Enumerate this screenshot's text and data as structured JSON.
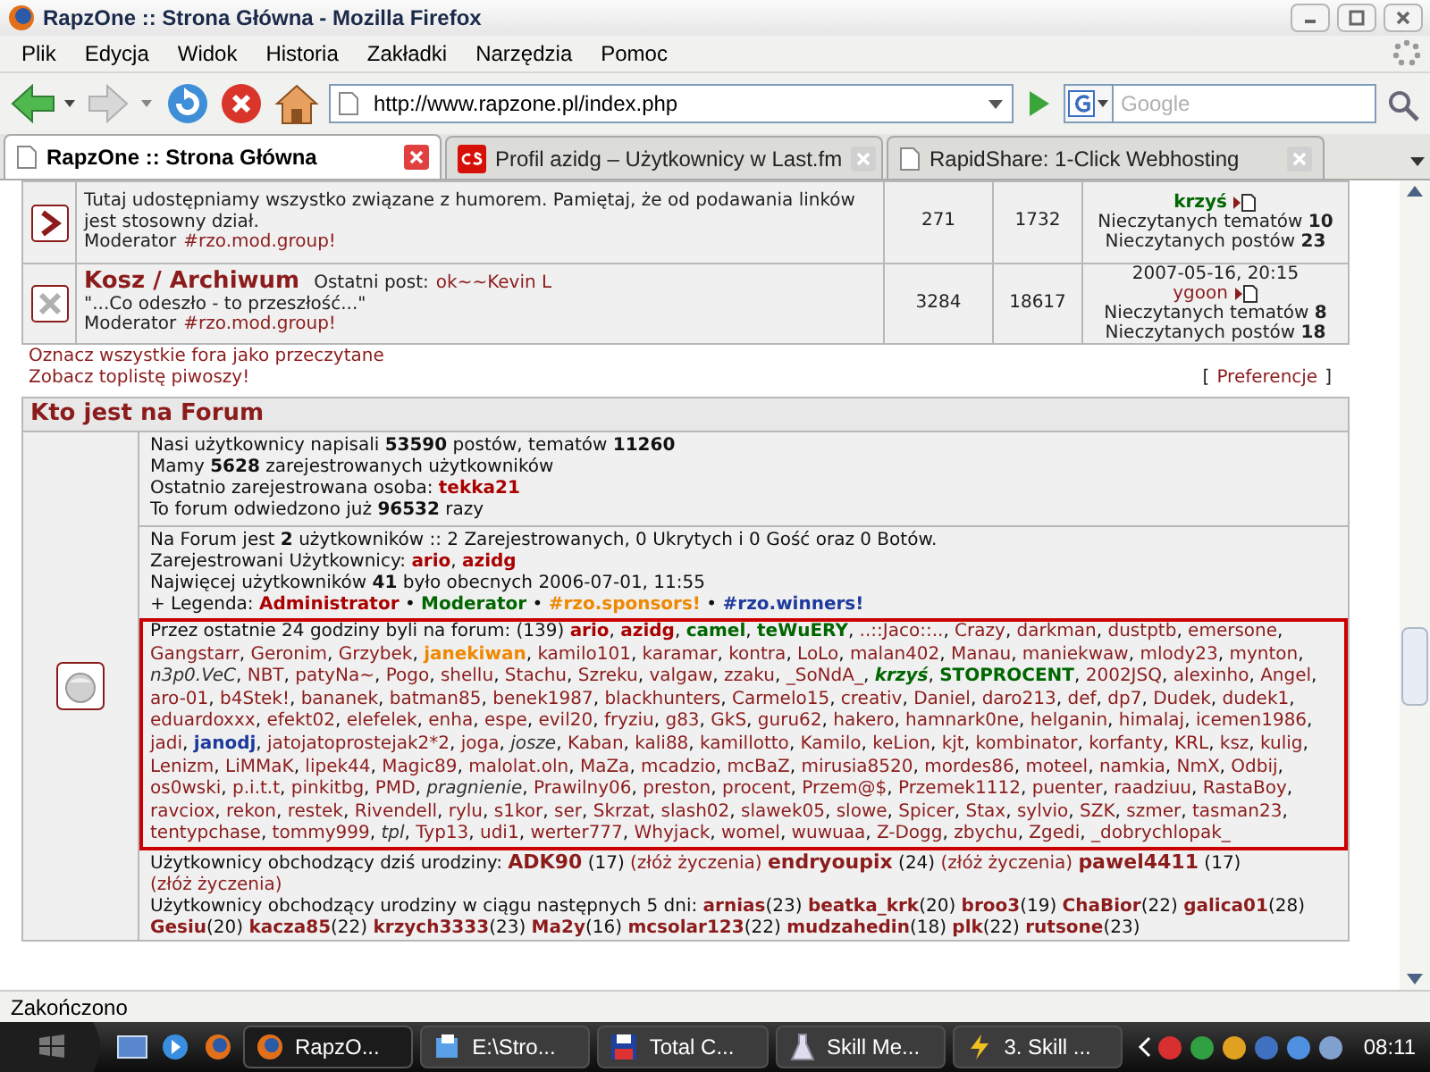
{
  "window": {
    "title": "RapzOne :: Strona Główna - Mozilla Firefox"
  },
  "menu": [
    "Plik",
    "Edycja",
    "Widok",
    "Historia",
    "Zakładki",
    "Narzędzia",
    "Pomoc"
  ],
  "toolbar": {
    "url": "http://www.rapzone.pl/index.php",
    "search_placeholder": "Google"
  },
  "tabs": [
    {
      "label": "RapzOne :: Strona Główna",
      "selected": true,
      "kind": "page"
    },
    {
      "label": "Profil azidg – Użytkownicy w Last.fm",
      "selected": false,
      "kind": "lastfm"
    },
    {
      "label": "RapidShare: 1-Click Webhosting",
      "selected": false,
      "kind": "page"
    }
  ],
  "forums": [
    {
      "kind": "new",
      "description": "Tutaj udostępniamy wszystko związane z humorem. Pamiętaj, że od podawania linków jest stosowny dział.",
      "moderator_label": "Moderator",
      "moderator": "#rzo.mod.group!",
      "topics": "271",
      "posts": "1732",
      "user": {
        "name": "krzyś",
        "kind": "moderator"
      },
      "unread_topics_label": "Nieczytanych tematów",
      "unread_topics": "10",
      "unread_posts_label": "Nieczytanych postów",
      "unread_posts": "23"
    },
    {
      "kind": "locked",
      "title": "Kosz / Archiwum",
      "last_label": "Ostatni post:",
      "last_user": "ok~~Kevin L",
      "description": "\"...Co odeszło - to przeszłość...\"",
      "moderator_label": "Moderator",
      "moderator": "#rzo.mod.group!",
      "topics": "3284",
      "posts": "18617",
      "date": "2007-05-16, 20:15",
      "user": {
        "name": "ygoon",
        "kind": "plain"
      },
      "unread_topics_label": "Nieczytanych tematów",
      "unread_topics": "8",
      "unread_posts_label": "Nieczytanych postów",
      "unread_posts": "18"
    }
  ],
  "links": [
    "Oznacz wszystkie fora jako przeczytane",
    "Zobacz toplistę piwoszy!"
  ],
  "preferences": {
    "open": "[",
    "label": "Preferencje",
    "close": "]"
  },
  "who": {
    "title": "Kto jest na Forum",
    "stats": [
      {
        "text": "Nasi użytkownicy napisali **53590** postów, tematów **11260**"
      },
      {
        "text": "Mamy **5628** zarejestrowanych użytkowników"
      },
      {
        "text": "Ostatnio zarejestrowana osoba:",
        "link": "tekka21"
      },
      {
        "text": "To forum odwiedzono już **96532** razy"
      }
    ],
    "online_line": "Na Forum jest **2** użytkowników :: 2 Zarejestrowanych, 0 Ukrytych i 0 Gość oraz 0 Botów.",
    "registered_label": "Zarejestrowani Użytkownicy:",
    "registered": [
      {
        "name": "ario",
        "kind": "admin"
      },
      {
        "name": "azidg",
        "kind": "admin"
      }
    ],
    "record_line": "Najwięcej użytkowników **41** było obecnych 2006-07-01, 11:55",
    "legend_label": "+ Legenda:",
    "legend": [
      {
        "name": "Administrator",
        "kind": "admin"
      },
      {
        "name": "Moderator",
        "kind": "moderator"
      },
      {
        "name": "#rzo.sponsors!",
        "kind": "sponsor"
      },
      {
        "name": "#rzo.winners!",
        "kind": "winner"
      }
    ],
    "legend_separator": "•",
    "separator": ",",
    "last24_intro": "Przez ostatnie 24 godziny byli na forum: (139)",
    "last24": [
      {
        "name": "ario",
        "kind": "admin"
      },
      {
        "name": "azidg",
        "kind": "admin"
      },
      {
        "name": "camel",
        "kind": "moderator"
      },
      {
        "name": "teWuERY",
        "kind": "moderator"
      },
      {
        "name": "..::Jaco::..",
        "kind": "plain"
      },
      {
        "name": "Crazy",
        "kind": "plain"
      },
      {
        "name": "darkman",
        "kind": "plain"
      },
      {
        "name": "dustptb",
        "kind": "plain"
      },
      {
        "name": "emersone",
        "kind": "plain"
      },
      {
        "name": "Gangstarr",
        "kind": "plain"
      },
      {
        "name": "Geronim",
        "kind": "plain"
      },
      {
        "name": "Grzybek",
        "kind": "plain"
      },
      {
        "name": "janekiwan",
        "kind": "sponsor"
      },
      {
        "name": "kamilo101",
        "kind": "plain"
      },
      {
        "name": "karamar",
        "kind": "plain"
      },
      {
        "name": "kontra",
        "kind": "plain"
      },
      {
        "name": "LoLo",
        "kind": "plain"
      },
      {
        "name": "malan402",
        "kind": "plain"
      },
      {
        "name": "Manau",
        "kind": "plain"
      },
      {
        "name": "maniekwaw",
        "kind": "plain"
      },
      {
        "name": "mlody23",
        "kind": "plain"
      },
      {
        "name": "mynton",
        "kind": "plain"
      },
      {
        "name": "n3p0.VeC",
        "kind": "italic"
      },
      {
        "name": "NBT",
        "kind": "plain"
      },
      {
        "name": "patyNa~",
        "kind": "plain"
      },
      {
        "name": "Pogo",
        "kind": "plain"
      },
      {
        "name": "shellu",
        "kind": "plain"
      },
      {
        "name": "Stachu",
        "kind": "plain"
      },
      {
        "name": "Szreku",
        "kind": "plain"
      },
      {
        "name": "valgaw",
        "kind": "plain"
      },
      {
        "name": "zzaku",
        "kind": "plain"
      },
      {
        "name": "_SoNdA_",
        "kind": "plain"
      },
      {
        "name": "krzyś",
        "kind": "moderator_italic"
      },
      {
        "name": "STOPROCENT",
        "kind": "moderator"
      },
      {
        "name": "2002JSQ",
        "kind": "plain"
      },
      {
        "name": "alexinho",
        "kind": "plain"
      },
      {
        "name": "Angel",
        "kind": "plain"
      },
      {
        "name": "aro-01",
        "kind": "plain"
      },
      {
        "name": "b4Stek!",
        "kind": "plain"
      },
      {
        "name": "bananek",
        "kind": "plain"
      },
      {
        "name": "batman85",
        "kind": "plain"
      },
      {
        "name": "benek1987",
        "kind": "plain"
      },
      {
        "name": "blackhunters",
        "kind": "plain"
      },
      {
        "name": "Carmelo15",
        "kind": "plain"
      },
      {
        "name": "creativ",
        "kind": "plain"
      },
      {
        "name": "Daniel",
        "kind": "plain"
      },
      {
        "name": "daro213",
        "kind": "plain"
      },
      {
        "name": "def",
        "kind": "plain"
      },
      {
        "name": "dp7",
        "kind": "plain"
      },
      {
        "name": "Dudek",
        "kind": "plain"
      },
      {
        "name": "dudek1",
        "kind": "plain"
      },
      {
        "name": "eduardoxxx",
        "kind": "plain"
      },
      {
        "name": "efekt02",
        "kind": "plain"
      },
      {
        "name": "elefelek",
        "kind": "plain"
      },
      {
        "name": "enha",
        "kind": "plain"
      },
      {
        "name": "espe",
        "kind": "plain"
      },
      {
        "name": "evil20",
        "kind": "plain"
      },
      {
        "name": "fryziu",
        "kind": "plain"
      },
      {
        "name": "g83",
        "kind": "plain"
      },
      {
        "name": "GkS",
        "kind": "plain"
      },
      {
        "name": "guru62",
        "kind": "plain"
      },
      {
        "name": "hakero",
        "kind": "plain"
      },
      {
        "name": "hamnark0ne",
        "kind": "plain"
      },
      {
        "name": "helganin",
        "kind": "plain"
      },
      {
        "name": "himalaj",
        "kind": "plain"
      },
      {
        "name": "icemen1986",
        "kind": "plain"
      },
      {
        "name": "jadi",
        "kind": "plain"
      },
      {
        "name": "janodj",
        "kind": "winner"
      },
      {
        "name": "jatojatoprostejak2*2",
        "kind": "plain"
      },
      {
        "name": "joga",
        "kind": "plain"
      },
      {
        "name": "josze",
        "kind": "italic"
      },
      {
        "name": "Kaban",
        "kind": "plain"
      },
      {
        "name": "kali88",
        "kind": "plain"
      },
      {
        "name": "kamillotto",
        "kind": "plain"
      },
      {
        "name": "Kamilo",
        "kind": "plain"
      },
      {
        "name": "keLion",
        "kind": "plain"
      },
      {
        "name": "kjt",
        "kind": "plain"
      },
      {
        "name": "kombinator",
        "kind": "plain"
      },
      {
        "name": "korfanty",
        "kind": "plain"
      },
      {
        "name": "KRL",
        "kind": "plain"
      },
      {
        "name": "ksz",
        "kind": "plain"
      },
      {
        "name": "kulig",
        "kind": "plain"
      },
      {
        "name": "Lenizm",
        "kind": "plain"
      },
      {
        "name": "LiMMaK",
        "kind": "plain"
      },
      {
        "name": "lipek44",
        "kind": "plain"
      },
      {
        "name": "Magic89",
        "kind": "plain"
      },
      {
        "name": "malolat.oln",
        "kind": "plain"
      },
      {
        "name": "MaZa",
        "kind": "plain"
      },
      {
        "name": "mcadzio",
        "kind": "plain"
      },
      {
        "name": "mcBaZ",
        "kind": "plain"
      },
      {
        "name": "mirusia8520",
        "kind": "plain"
      },
      {
        "name": "mordes86",
        "kind": "plain"
      },
      {
        "name": "moteel",
        "kind": "plain"
      },
      {
        "name": "namkia",
        "kind": "plain"
      },
      {
        "name": "NmX",
        "kind": "plain"
      },
      {
        "name": "Odbij",
        "kind": "plain"
      },
      {
        "name": "os0wski",
        "kind": "plain"
      },
      {
        "name": "p.i.t.t",
        "kind": "plain"
      },
      {
        "name": "pinkitbg",
        "kind": "plain"
      },
      {
        "name": "PMD",
        "kind": "plain"
      },
      {
        "name": "pragnienie",
        "kind": "italic"
      },
      {
        "name": "Prawilny06",
        "kind": "plain"
      },
      {
        "name": "preston",
        "kind": "plain"
      },
      {
        "name": "procent",
        "kind": "plain"
      },
      {
        "name": "Przem@$",
        "kind": "plain"
      },
      {
        "name": "Przemek1112",
        "kind": "plain"
      },
      {
        "name": "puenter",
        "kind": "plain"
      },
      {
        "name": "raadziuu",
        "kind": "plain"
      },
      {
        "name": "RastaBoy",
        "kind": "plain"
      },
      {
        "name": "ravciox",
        "kind": "plain"
      },
      {
        "name": "rekon",
        "kind": "plain"
      },
      {
        "name": "restek",
        "kind": "plain"
      },
      {
        "name": "Rivendell",
        "kind": "plain"
      },
      {
        "name": "rylu",
        "kind": "plain"
      },
      {
        "name": "s1kor",
        "kind": "plain"
      },
      {
        "name": "ser",
        "kind": "plain"
      },
      {
        "name": "Skrzat",
        "kind": "plain"
      },
      {
        "name": "slash02",
        "kind": "plain"
      },
      {
        "name": "slawek05",
        "kind": "plain"
      },
      {
        "name": "slowe",
        "kind": "plain"
      },
      {
        "name": "Spicer",
        "kind": "plain"
      },
      {
        "name": "Stax",
        "kind": "plain"
      },
      {
        "name": "sylvio",
        "kind": "plain"
      },
      {
        "name": "SZK",
        "kind": "plain"
      },
      {
        "name": "szmer",
        "kind": "plain"
      },
      {
        "name": "tasman23",
        "kind": "plain"
      },
      {
        "name": "tentypchase",
        "kind": "plain"
      },
      {
        "name": "tommy999",
        "kind": "plain"
      },
      {
        "name": "tpl",
        "kind": "italic"
      },
      {
        "name": "Typ13",
        "kind": "plain"
      },
      {
        "name": "udi1",
        "kind": "plain"
      },
      {
        "name": "werter777",
        "kind": "plain"
      },
      {
        "name": "Whyjack",
        "kind": "plain"
      },
      {
        "name": "womel",
        "kind": "plain"
      },
      {
        "name": "wuwuaa",
        "kind": "plain"
      },
      {
        "name": "Z-Dogg",
        "kind": "plain"
      },
      {
        "name": "zbychu",
        "kind": "plain"
      },
      {
        "name": "Zgedi",
        "kind": "plain"
      },
      {
        "name": "_dobrychlopak_",
        "kind": "plain"
      }
    ],
    "birthdays_today_label": "Użytkownicy obchodzący dziś urodziny:",
    "birthdays_today": [
      {
        "name": "ADK90",
        "age": "(17)",
        "wish": "(złóż życzenia)"
      },
      {
        "name": "endryoupix",
        "age": "(24)",
        "wish": "(złóż życzenia)"
      },
      {
        "name": "pawel4411",
        "age": "(17)",
        "wish": "(złóż życzenia)"
      }
    ],
    "birthdays_next_label": "Użytkownicy obchodzący urodziny w ciągu następnych 5 dni:",
    "birthdays_next": [
      {
        "name": "arnias",
        "age": "(23)"
      },
      {
        "name": "beatka_krk",
        "age": "(20)"
      },
      {
        "name": "broo3",
        "age": "(19)"
      },
      {
        "name": "ChaBior",
        "age": "(22)"
      },
      {
        "name": "galica01",
        "age": "(28)"
      },
      {
        "name": "Gesiu",
        "age": "(20)"
      },
      {
        "name": "kacza85",
        "age": "(22)"
      },
      {
        "name": "krzych3333",
        "age": "(23)"
      },
      {
        "name": "Ma2y",
        "age": "(16)"
      },
      {
        "name": "mcsolar123",
        "age": "(22)"
      },
      {
        "name": "mudzahedin",
        "age": "(18)"
      },
      {
        "name": "plk",
        "age": "(22)"
      },
      {
        "name": "rutsone",
        "age": "(23)"
      }
    ]
  },
  "status_bar": "Zakończono",
  "taskbar": {
    "tasks": [
      {
        "label": "RapzO...",
        "selected": true,
        "kind": "firefox"
      },
      {
        "label": "E:\\Stro...",
        "selected": false,
        "kind": "folder"
      },
      {
        "label": "Total C...",
        "selected": false,
        "kind": "disk"
      },
      {
        "label": "Skill Me...",
        "selected": false,
        "kind": "flask"
      },
      {
        "label": "3. Skill ...",
        "selected": false,
        "kind": "bolt"
      }
    ],
    "clock": "08:11"
  }
}
